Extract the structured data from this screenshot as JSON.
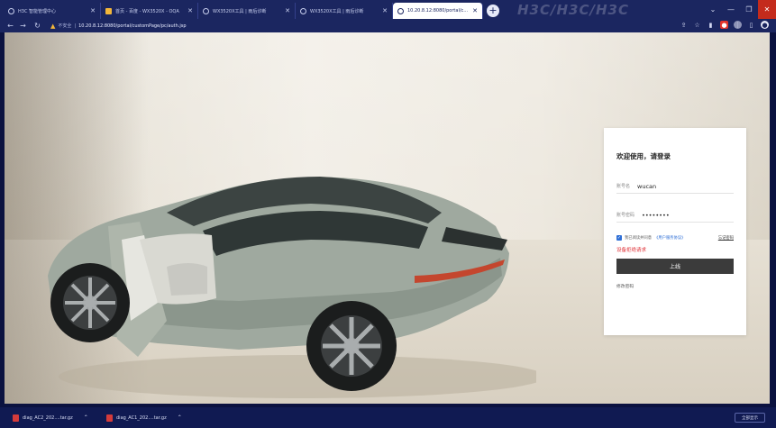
{
  "browser": {
    "tabs": [
      {
        "title": "H3C 智能管理中心",
        "active": false,
        "icon": "globe-icon"
      },
      {
        "title": "首页 - 百度 - WX3520X - OQA",
        "active": false,
        "icon": "warning-icon"
      },
      {
        "title": "WX3520X工具 | 雨后诊断",
        "active": false,
        "icon": "globe-icon"
      },
      {
        "title": "WX3520X工具 | 雨后诊断",
        "active": false,
        "icon": "globe-icon"
      },
      {
        "title": "10.20.8.12:8080/portal/custo",
        "active": true,
        "icon": "globe-icon"
      }
    ],
    "new_tab_label": "+",
    "watermark": "H3C/H3C/H3C",
    "address": {
      "security_label": "不安全",
      "url": "10.20.8.12:8080/portal/customPage/pc/auth.jsp"
    },
    "toolbar_icons": [
      "share-icon",
      "star-icon",
      "extension-icon",
      "extension-icon",
      "menu-icon",
      "profile-icon"
    ]
  },
  "login": {
    "welcome": "欢迎使用，请登录",
    "username_label": "账号名",
    "username_value": "wucan",
    "password_label": "账号密码",
    "password_value": "••••••••",
    "agree_text": "我已阅读并同意",
    "agree_link": "《用户服务协议》",
    "right_link": "忘记密码",
    "error_message": "设备拒绝请求",
    "login_button": "上线",
    "change_password": "修改密码"
  },
  "downloads": {
    "items": [
      {
        "name": "diag_AC2_202....tar.gz"
      },
      {
        "name": "diag_AC1_202....tar.gz"
      }
    ],
    "show_all": "全部显示"
  },
  "colors": {
    "browser_frame": "#1b2660",
    "login_button": "#3b3b3b",
    "error": "#e0343a",
    "link": "#2f6fd6"
  }
}
